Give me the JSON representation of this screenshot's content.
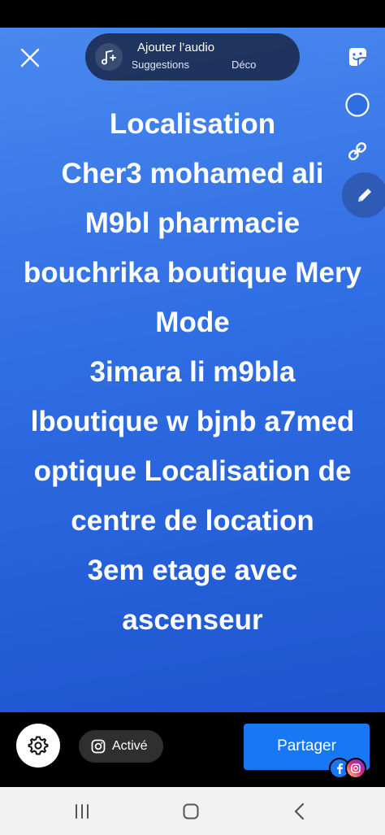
{
  "audio": {
    "title": "Ajouter l’audio",
    "tab_left": "Suggestions",
    "tab_right": "Découvrir"
  },
  "story": {
    "lines": [
      "Localisation",
      "Cher3 mohamed ali",
      "M9bl pharmacie",
      "bouchrika boutique Mery",
      "Mode",
      "3imara li m9bla",
      "lboutique w bjnb a7med",
      "optique Localisation de",
      "centre de location",
      "3em etage avec",
      "ascenseur"
    ]
  },
  "bottom": {
    "active_label": "Activé",
    "share_label": "Partager"
  },
  "icons": {
    "close": "close-icon",
    "music": "music-add-icon",
    "sticker": "sticker-icon",
    "color": "color-circle-icon",
    "link": "link-icon",
    "pen": "pen-icon",
    "settings": "gear-icon",
    "instagram": "instagram-icon",
    "facebook": "facebook-icon",
    "recents": "recents-icon",
    "home": "home-icon",
    "back": "back-icon"
  },
  "colors": {
    "background_top": "#4a88ef",
    "background_bottom": "#1d55cf",
    "share_button": "#1877f2"
  }
}
